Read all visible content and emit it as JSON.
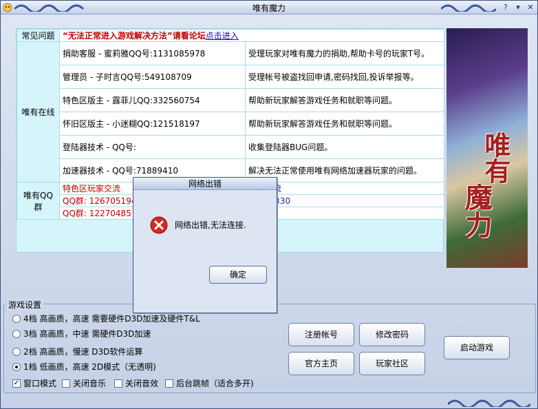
{
  "window": {
    "title": "唯有魔力"
  },
  "table": {
    "faq": {
      "category": "常见问题",
      "notice": "“无法正常进入游戏解决方法”请看论坛",
      "link": "点击进入"
    },
    "online": {
      "category": "唯有在线",
      "rows": [
        {
          "role": "捐助客服 - 蜜莉雅QQ号:1131085978",
          "desc": "受理玩家对唯有魔力的捐助,帮助卡号的玩家T号。"
        },
        {
          "role": "管理员 - 子时言QQ号:549108709",
          "desc": "受理帐号被盗找回申请,密码找回,投诉举报等。"
        },
        {
          "role": "特色区版主 - 露菲儿QQ:332560754",
          "desc": "帮助新玩家解答游戏任务和就职等问题。"
        },
        {
          "role": "怀旧区版主 - 小迷糊QQ:121518197",
          "desc": "帮助新玩家解答游戏任务和就职等问题。"
        },
        {
          "role": "登陆器技术 - QQ号:",
          "desc": "收集登陆器BUG问题。"
        },
        {
          "role": "加速器技术 - QQ号:71889410",
          "desc": "解决无法正常使用唯有网络加速器玩家的问题。"
        }
      ]
    },
    "groups": {
      "category": "唯有QQ群",
      "left_header": "特色区玩家交流",
      "left_1": "QQ群: 126705194",
      "left_2": "QQ群: 12270485",
      "right_header": "玩家交流",
      "right_1": "54592330"
    }
  },
  "banner": {
    "line1": "唯有",
    "line2": "魔力"
  },
  "settings": {
    "legend": "游戏设置",
    "quality_options": [
      {
        "label": "4档 高画质，高速 需要硬件D3D加速及硬件T&L",
        "selected": false
      },
      {
        "label": "3档 高画质，中速 需硬件D3D加速",
        "selected": false
      },
      {
        "label": "2档 高画质，慢速 D3D软件运算",
        "selected": false
      },
      {
        "label": "1档 低画质，高速 2D模式（无透明)",
        "selected": true
      }
    ],
    "checkboxes": [
      {
        "label": "窗口模式",
        "checked": true
      },
      {
        "label": "关闭音乐",
        "checked": false
      },
      {
        "label": "关闭音效",
        "checked": false
      },
      {
        "label": "后台跳帧（适合多开)",
        "checked": false
      }
    ]
  },
  "buttons": {
    "register": "注册帐号",
    "change_password": "修改密码",
    "homepage": "官方主页",
    "community": "玩家社区",
    "start": "启动游戏"
  },
  "dialog": {
    "title": "网络出错",
    "message": "网络出错,无法连接.",
    "ok": "确定"
  }
}
